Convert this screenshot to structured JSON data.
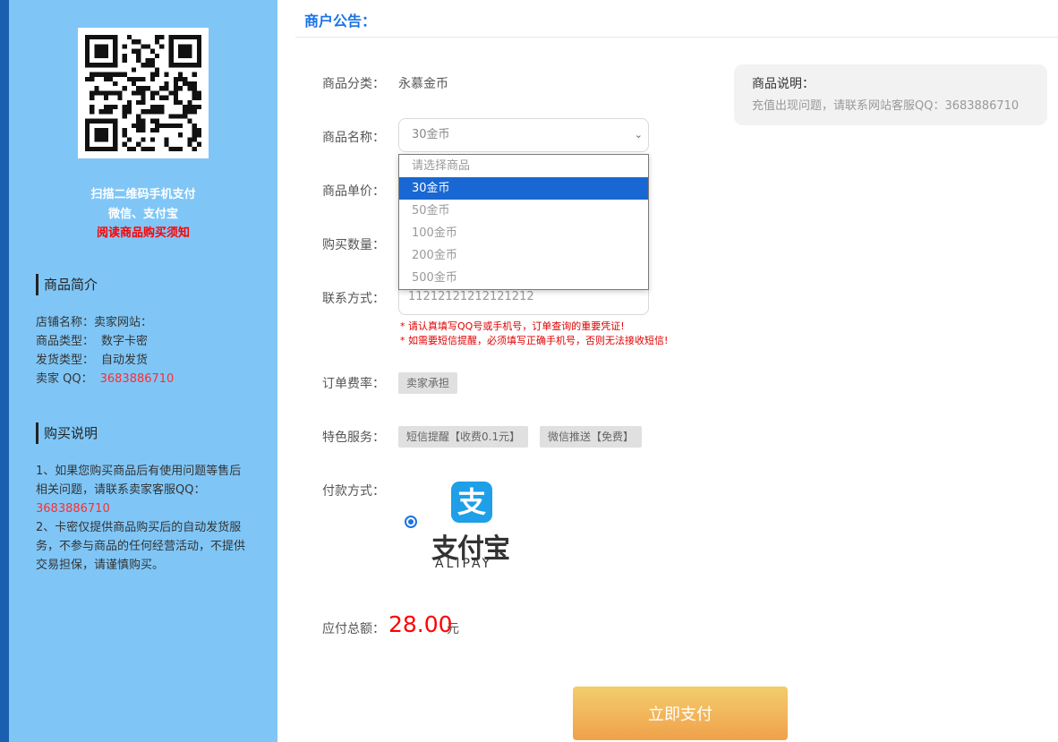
{
  "sidebar": {
    "qr_caption_line1": "扫描二维码手机支付",
    "qr_caption_line2": "微信、支付宝",
    "qr_caption_link": "阅读商品购买须知",
    "intro_heading": "商品简介",
    "info": [
      {
        "label": "店铺名称：",
        "value": "卖家网站："
      },
      {
        "label": "商品类型：",
        "value": "数字卡密"
      },
      {
        "label": "发货类型：",
        "value": "自动发货"
      },
      {
        "label": "卖家 QQ：",
        "value": "3683886710"
      }
    ],
    "purchase_heading": "购买说明",
    "notice_line1_pre": "1、如果您购买商品后有使用问题等售后相关问题，请联系卖家客服QQ：",
    "notice_qq": "3683886710",
    "notice_line2": "2、卡密仅提供商品购买后的自动发货服务，不参与商品的任何经营活动，不提供交易担保，请谨慎购买。"
  },
  "main": {
    "notice_title": "商户公告：",
    "description": {
      "title": "商品说明：",
      "text": "充值出现问题，请联系网站客服QQ：3683886710"
    },
    "labels": {
      "category": "商品分类：",
      "name": "商品名称：",
      "price": "商品单价：",
      "quantity": "购买数量：",
      "contact": "联系方式：",
      "fee": "订单费率：",
      "service": "特色服务：",
      "payment": "付款方式：",
      "total": "应付总额："
    },
    "category_value": "永慕金币",
    "product_select": {
      "selected": "30金币",
      "options": [
        "请选择商品",
        "30金币",
        "50金币",
        "100金币",
        "200金币",
        "500金币"
      ],
      "highlighted_index": 1
    },
    "contact_placeholder": "11212121212121212",
    "hints": [
      "* 请认真填写QQ号或手机号，订单查询的重要凭证!",
      "* 如需要短信提醒，必须填写正确手机号，否则无法接收短信!"
    ],
    "fee_tag": "卖家承担",
    "service_tags": [
      "短信提醒【收费0.1元】",
      "微信推送【免费】"
    ],
    "payment_method": {
      "icon_char": "支",
      "name_cn": "支付宝",
      "name_en": "ALIPAY",
      "selected": true
    },
    "total_amount": "28.00",
    "total_unit": "元",
    "pay_button": "立即支付"
  },
  "colors": {
    "sidebar_bg": "#7fc6f7",
    "accent_blue": "#1a73e8",
    "price_red": "#ff0000",
    "alipay_blue": "#1e9fe8"
  }
}
